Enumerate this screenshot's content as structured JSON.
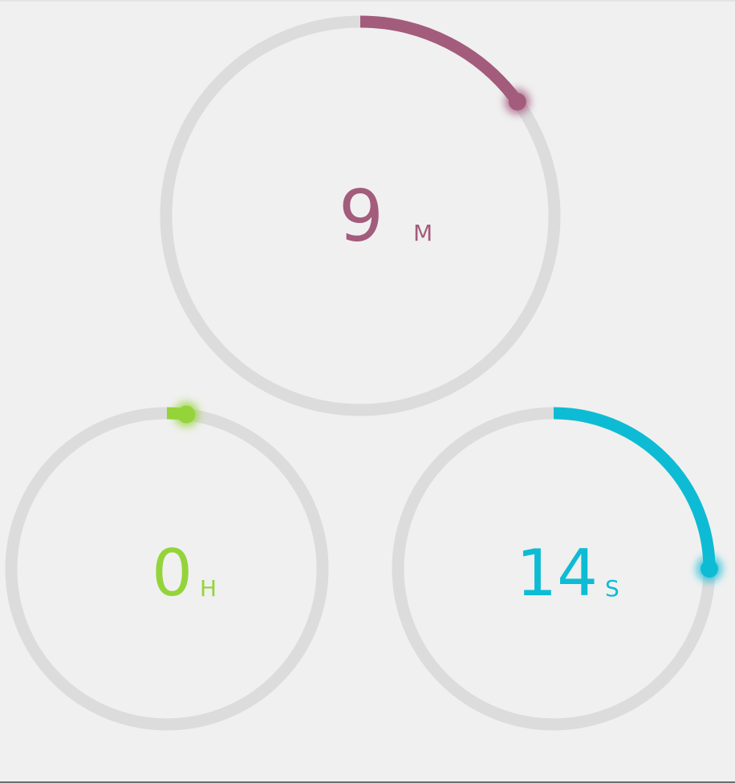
{
  "timer": {
    "minutes": {
      "value": "9",
      "unit": "M",
      "progress": 0.15,
      "color": "#a35c7c",
      "track_color": "#dcdcdc"
    },
    "hours": {
      "value": "0",
      "unit": "H",
      "progress": 0.02,
      "color": "#94d43a",
      "track_color": "#dcdcdc"
    },
    "seconds": {
      "value": "14",
      "unit": "S",
      "progress": 0.25,
      "color": "#0dbcd4",
      "track_color": "#dcdcdc"
    }
  }
}
